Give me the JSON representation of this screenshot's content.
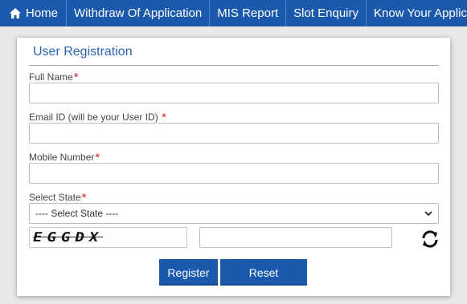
{
  "nav": {
    "items": [
      {
        "label": "Home",
        "icon": "home-icon"
      },
      {
        "label": "Withdraw Of Application"
      },
      {
        "label": "MIS Report"
      },
      {
        "label": "Slot Enquiry"
      },
      {
        "label": "Know Your Application Status"
      }
    ]
  },
  "form": {
    "title": "User Registration",
    "required_marker": "*",
    "fields": {
      "full_name": {
        "label": "Full Name",
        "value": ""
      },
      "email": {
        "label": "Email ID (will be your User ID) ",
        "value": ""
      },
      "mobile": {
        "label": "Mobile Number",
        "value": ""
      },
      "state": {
        "label": "Select State",
        "selected": "---- Select State ----"
      }
    },
    "captcha": {
      "text": "EGGDX",
      "value": "",
      "refresh_icon": "refresh-icon"
    },
    "buttons": {
      "register": "Register",
      "reset": "Reset"
    }
  },
  "colors": {
    "nav_bg": "#1b59ad",
    "accent": "#2b65b1",
    "required": "#d9262c",
    "button_bg": "#1b59ad"
  }
}
